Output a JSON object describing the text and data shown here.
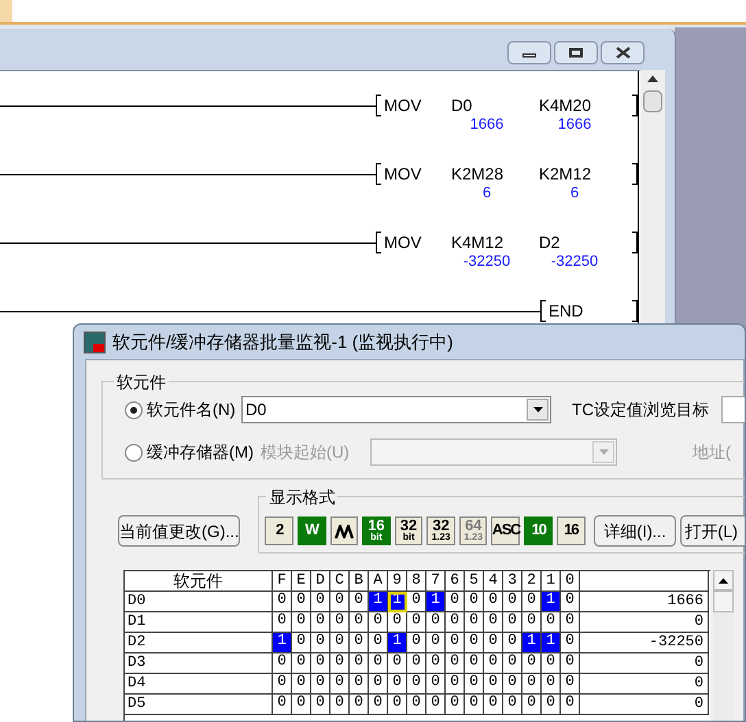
{
  "ladder": {
    "rungs": [
      {
        "kind": "instruction",
        "instruction": "MOV",
        "operands": [
          {
            "device": "D0",
            "value": "1666"
          },
          {
            "device": "K4M20",
            "value": "1666"
          }
        ]
      },
      {
        "kind": "instruction",
        "instruction": "MOV",
        "operands": [
          {
            "device": "K2M28",
            "value": "6"
          },
          {
            "device": "K2M12",
            "value": "6"
          }
        ]
      },
      {
        "kind": "instruction",
        "instruction": "MOV",
        "operands": [
          {
            "device": "K4M12",
            "value": "-32250"
          },
          {
            "device": "D2",
            "value": "-32250"
          }
        ]
      },
      {
        "kind": "end",
        "instruction": "END"
      }
    ]
  },
  "dialog": {
    "title": "软元件/缓冲存储器批量监视-1 (监视执行中)",
    "device_group": {
      "legend": "软元件",
      "options": [
        {
          "label": "软元件名(N)",
          "selected": true
        },
        {
          "label": "缓冲存储器(M)",
          "selected": false
        }
      ],
      "device_name": "D0",
      "tc_label": "TC设定值浏览目标",
      "module_start_label": "模块起始(U)",
      "address_label": "地址("
    },
    "change_button": "当前值更改(G)...",
    "display_format": {
      "legend": "显示格式",
      "buttons": [
        {
          "kind": "text",
          "label": "2",
          "selected": false,
          "disabled": false
        },
        {
          "kind": "text",
          "label": "W",
          "selected": true,
          "disabled": false
        },
        {
          "kind": "icon",
          "selected": false,
          "disabled": false
        },
        {
          "kind": "stacked",
          "label": "16",
          "sublabel": "bit",
          "selected": true,
          "disabled": false
        },
        {
          "kind": "stacked",
          "label": "32",
          "sublabel": "bit",
          "selected": false,
          "disabled": false
        },
        {
          "kind": "stacked",
          "label": "32",
          "sublabel": "1.23",
          "selected": false,
          "disabled": false
        },
        {
          "kind": "stacked",
          "label": "64",
          "sublabel": "1.23",
          "selected": false,
          "disabled": true
        },
        {
          "kind": "text",
          "label": "ASC",
          "selected": false,
          "disabled": false
        },
        {
          "kind": "text",
          "label": "10",
          "selected": true,
          "disabled": false
        },
        {
          "kind": "text",
          "label": "16",
          "selected": false,
          "disabled": false
        }
      ]
    },
    "detail_button": "详细(I)...",
    "open_button": "打开(L)",
    "table": {
      "columns": {
        "device": "软元件",
        "bits": [
          "F",
          "E",
          "D",
          "C",
          "B",
          "A",
          "9",
          "8",
          "7",
          "6",
          "5",
          "4",
          "3",
          "2",
          "1",
          "0"
        ]
      },
      "rows": [
        {
          "device": "D0",
          "value": "1666",
          "bits": [
            "0",
            "0",
            "0",
            "0",
            "0",
            "1",
            "1",
            "0",
            "1",
            "0",
            "0",
            "0",
            "0",
            "0",
            "1",
            "0"
          ],
          "on": [
            false,
            false,
            false,
            false,
            false,
            true,
            true,
            false,
            true,
            false,
            false,
            false,
            false,
            false,
            true,
            false
          ],
          "cursor": [
            false,
            false,
            false,
            false,
            false,
            false,
            true,
            false,
            false,
            false,
            false,
            false,
            false,
            false,
            false,
            false
          ]
        },
        {
          "device": "D1",
          "value": "0",
          "bits": [
            "0",
            "0",
            "0",
            "0",
            "0",
            "0",
            "0",
            "0",
            "0",
            "0",
            "0",
            "0",
            "0",
            "0",
            "0",
            "0"
          ],
          "on": [
            false,
            false,
            false,
            false,
            false,
            false,
            false,
            false,
            false,
            false,
            false,
            false,
            false,
            false,
            false,
            false
          ],
          "cursor": [
            false,
            false,
            false,
            false,
            false,
            false,
            false,
            false,
            false,
            false,
            false,
            false,
            false,
            false,
            false,
            false
          ]
        },
        {
          "device": "D2",
          "value": "-32250",
          "bits": [
            "1",
            "0",
            "0",
            "0",
            "0",
            "0",
            "1",
            "0",
            "0",
            "0",
            "0",
            "0",
            "0",
            "1",
            "1",
            "0"
          ],
          "on": [
            true,
            false,
            false,
            false,
            false,
            false,
            true,
            false,
            false,
            false,
            false,
            false,
            false,
            true,
            true,
            false
          ],
          "cursor": [
            false,
            false,
            false,
            false,
            false,
            false,
            false,
            false,
            false,
            false,
            false,
            false,
            false,
            false,
            false,
            false
          ]
        },
        {
          "device": "D3",
          "value": "0",
          "bits": [
            "0",
            "0",
            "0",
            "0",
            "0",
            "0",
            "0",
            "0",
            "0",
            "0",
            "0",
            "0",
            "0",
            "0",
            "0",
            "0"
          ],
          "on": [
            false,
            false,
            false,
            false,
            false,
            false,
            false,
            false,
            false,
            false,
            false,
            false,
            false,
            false,
            false,
            false
          ],
          "cursor": [
            false,
            false,
            false,
            false,
            false,
            false,
            false,
            false,
            false,
            false,
            false,
            false,
            false,
            false,
            false,
            false
          ]
        },
        {
          "device": "D4",
          "value": "0",
          "bits": [
            "0",
            "0",
            "0",
            "0",
            "0",
            "0",
            "0",
            "0",
            "0",
            "0",
            "0",
            "0",
            "0",
            "0",
            "0",
            "0"
          ],
          "on": [
            false,
            false,
            false,
            false,
            false,
            false,
            false,
            false,
            false,
            false,
            false,
            false,
            false,
            false,
            false,
            false
          ],
          "cursor": [
            false,
            false,
            false,
            false,
            false,
            false,
            false,
            false,
            false,
            false,
            false,
            false,
            false,
            false,
            false,
            false
          ]
        },
        {
          "device": "D5",
          "value": "0",
          "bits": [
            "0",
            "0",
            "0",
            "0",
            "0",
            "0",
            "0",
            "0",
            "0",
            "0",
            "0",
            "0",
            "0",
            "0",
            "0",
            "0"
          ],
          "on": [
            false,
            false,
            false,
            false,
            false,
            false,
            false,
            false,
            false,
            false,
            false,
            false,
            false,
            false,
            false,
            false
          ],
          "cursor": [
            false,
            false,
            false,
            false,
            false,
            false,
            false,
            false,
            false,
            false,
            false,
            false,
            false,
            false,
            false,
            false
          ]
        }
      ]
    }
  }
}
